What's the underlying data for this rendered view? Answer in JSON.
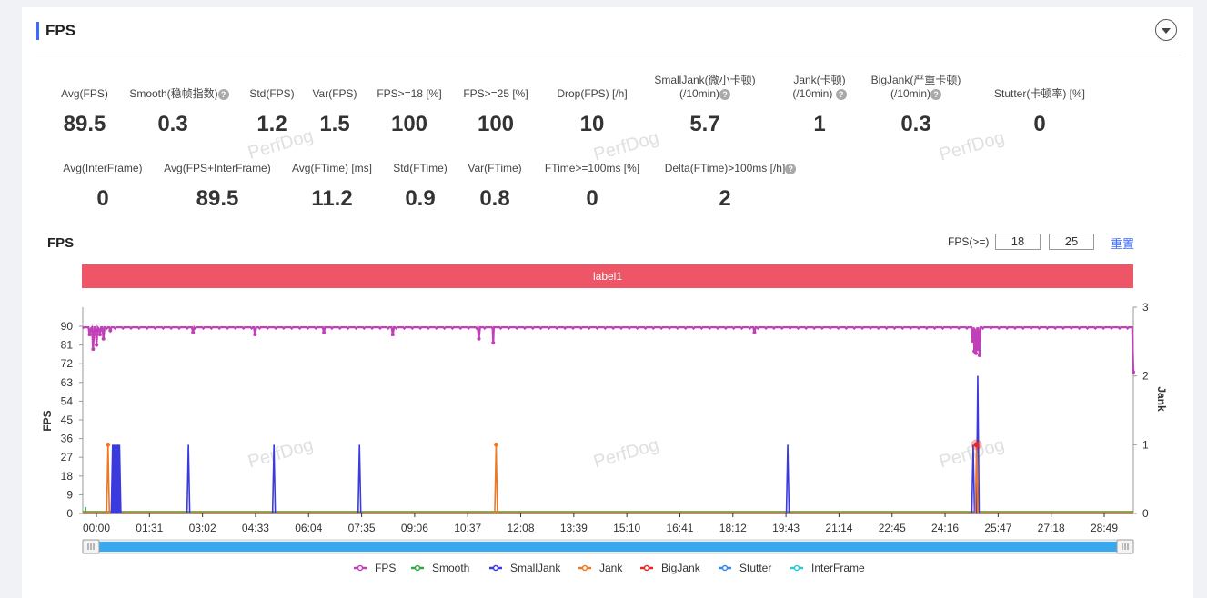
{
  "header": {
    "title": "FPS"
  },
  "metrics_row1": [
    {
      "label": "Avg(FPS)",
      "value": "89.5",
      "help": false
    },
    {
      "label": "Smooth(稳帧指数)",
      "value": "0.3",
      "help": true
    },
    {
      "label": "Std(FPS)",
      "value": "1.2",
      "help": false
    },
    {
      "label": "Var(FPS)",
      "value": "1.5",
      "help": false
    },
    {
      "label": "FPS>=18 [%]",
      "value": "100",
      "help": false
    },
    {
      "label": "FPS>=25 [%]",
      "value": "100",
      "help": false
    },
    {
      "label": "Drop(FPS) [/h]",
      "value": "10",
      "help": false
    },
    {
      "label": "SmallJank(微小卡顿)",
      "label2": "(/10min)",
      "value": "5.7",
      "help": true
    },
    {
      "label": "Jank(卡顿)",
      "label2": "(/10min)",
      "value": "1",
      "help": true
    },
    {
      "label": "BigJank(严重卡顿)",
      "label2": "(/10min)",
      "value": "0.3",
      "help": true
    },
    {
      "label": "Stutter(卡顿率) [%]",
      "value": "0",
      "help": false
    }
  ],
  "metrics_row2": [
    {
      "label": "Avg(InterFrame)",
      "value": "0"
    },
    {
      "label": "Avg(FPS+InterFrame)",
      "value": "89.5"
    },
    {
      "label": "Avg(FTime) [ms]",
      "value": "11.2"
    },
    {
      "label": "Std(FTime)",
      "value": "0.9"
    },
    {
      "label": "Var(FTime)",
      "value": "0.8"
    },
    {
      "label": "FTime>=100ms [%]",
      "value": "0"
    },
    {
      "label": "Delta(FTime)>100ms [/h]",
      "value": "2"
    }
  ],
  "chart_section": {
    "title": "FPS",
    "fps_threshold_label": "FPS(>=)",
    "threshold1": "18",
    "threshold2": "25",
    "reset_label": "重置",
    "label_bar": "label1",
    "watermark": "PerfDog"
  },
  "colors": {
    "accent": "#3d6bff",
    "label_bar": "#ee5668",
    "fps": "#c040b8",
    "smooth": "#2ea84a",
    "smalljank": "#3a3adf",
    "jank": "#f07820",
    "bigjank": "#e02a2a",
    "stutter": "#3a86e8",
    "interframe": "#2cc8d8",
    "slider": "#3aa8ee"
  },
  "chart_data": {
    "type": "line",
    "xlabel": "",
    "ylabel": "FPS",
    "y2label": "Jank",
    "ylim": [
      0,
      90
    ],
    "y2lim": [
      0,
      3
    ],
    "y_ticks": [
      "0",
      "9",
      "18",
      "27",
      "36",
      "45",
      "54",
      "63",
      "72",
      "81",
      "90"
    ],
    "y2_ticks": [
      "0",
      "1",
      "2",
      "3"
    ],
    "x_ticks": [
      "00:00",
      "01:31",
      "03:02",
      "04:33",
      "06:04",
      "07:35",
      "09:06",
      "10:37",
      "12:08",
      "13:39",
      "15:10",
      "16:41",
      "18:12",
      "19:43",
      "21:14",
      "22:45",
      "24:16",
      "25:47",
      "27:18",
      "28:49"
    ],
    "duration_sec": 1830,
    "fps_baseline": 89.5,
    "fps_dips": [
      [
        12,
        86
      ],
      [
        18,
        79
      ],
      [
        24,
        81
      ],
      [
        30,
        86
      ],
      [
        36,
        84
      ],
      [
        48,
        88
      ],
      [
        192,
        87
      ],
      [
        300,
        86
      ],
      [
        420,
        87
      ],
      [
        540,
        86
      ],
      [
        690,
        84
      ],
      [
        715,
        82
      ],
      [
        1170,
        87
      ],
      [
        1550,
        83
      ],
      [
        1553,
        78
      ],
      [
        1556,
        77
      ],
      [
        1559,
        79
      ],
      [
        1562,
        76
      ],
      [
        1830,
        68
      ]
    ],
    "series": [
      {
        "name": "FPS",
        "axis": "left"
      },
      {
        "name": "Smooth",
        "axis": "left",
        "values": [
          [
            5,
            3
          ],
          [
            1830,
            3
          ]
        ]
      },
      {
        "name": "SmallJank",
        "axis": "right",
        "events": [
          [
            52,
            1
          ],
          [
            54,
            1
          ],
          [
            56,
            1
          ],
          [
            58,
            1
          ],
          [
            60,
            1
          ],
          [
            62,
            1
          ],
          [
            64,
            1
          ],
          [
            184,
            1
          ],
          [
            333,
            1
          ],
          [
            482,
            1
          ],
          [
            1228,
            1
          ],
          [
            1551,
            1
          ],
          [
            1559,
            2
          ]
        ]
      },
      {
        "name": "Jank",
        "axis": "right",
        "events": [
          [
            44,
            1
          ],
          [
            720,
            1
          ],
          [
            1557,
            1
          ]
        ]
      },
      {
        "name": "BigJank",
        "axis": "right",
        "events": [
          [
            1557,
            1
          ]
        ]
      },
      {
        "name": "Stutter",
        "axis": "right"
      },
      {
        "name": "InterFrame",
        "axis": "right"
      }
    ]
  }
}
